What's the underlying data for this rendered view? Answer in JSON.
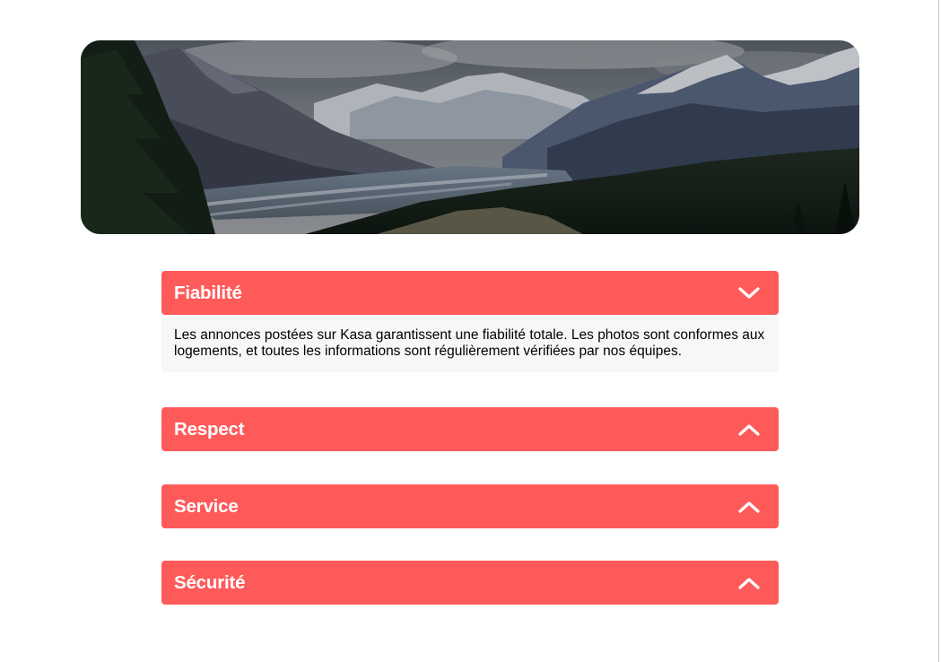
{
  "banner": {
    "image": "mountain-landscape-image"
  },
  "accordion": [
    {
      "title": "Fiabilité",
      "expanded": true,
      "icon": "chevron-down-icon",
      "content": "Les annonces postées sur Kasa garantissent une fiabilité totale. Les photos sont conformes aux logements, et toutes les informations sont régulièrement vérifiées par nos équipes."
    },
    {
      "title": "Respect",
      "expanded": false,
      "icon": "chevron-up-icon"
    },
    {
      "title": "Service",
      "expanded": false,
      "icon": "chevron-up-icon"
    },
    {
      "title": "Sécurité",
      "expanded": false,
      "icon": "chevron-up-icon"
    }
  ],
  "colors": {
    "accent": "#ff5a5a",
    "body_bg": "#f7f7f7",
    "text": "#000000"
  }
}
